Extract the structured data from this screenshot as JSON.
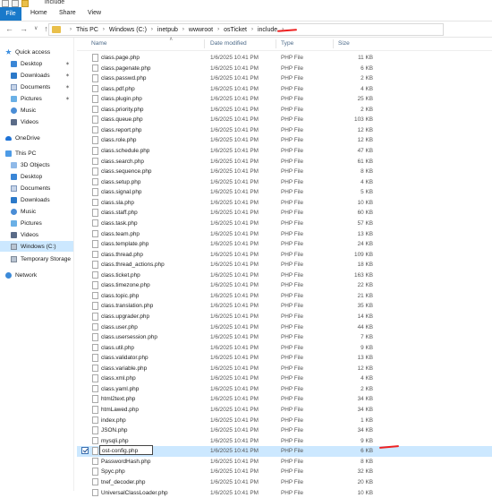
{
  "window": {
    "title": "include"
  },
  "ribbon": {
    "tabs": [
      "File",
      "Home",
      "Share",
      "View"
    ]
  },
  "address": {
    "crumbs": [
      "This PC",
      "Windows (C:)",
      "inetpub",
      "wwwroot",
      "osTicket",
      "include"
    ]
  },
  "sidebar": {
    "items": [
      {
        "label": "Quick access",
        "icon": "star-icon",
        "pinned": false
      },
      {
        "label": "Desktop",
        "icon": "desktop-icon",
        "pinned": true
      },
      {
        "label": "Downloads",
        "icon": "downloads-icon",
        "pinned": true
      },
      {
        "label": "Documents",
        "icon": "documents-icon",
        "pinned": true
      },
      {
        "label": "Pictures",
        "icon": "pictures-icon",
        "pinned": true
      },
      {
        "label": "Music",
        "icon": "music-icon",
        "pinned": false
      },
      {
        "label": "Videos",
        "icon": "videos-icon",
        "pinned": false
      },
      {
        "label": "OneDrive",
        "icon": "onedrive-icon",
        "pinned": false
      },
      {
        "label": "This PC",
        "icon": "pc-icon",
        "pinned": false
      },
      {
        "label": "3D Objects",
        "icon": "3d-objects-icon",
        "pinned": false
      },
      {
        "label": "Desktop",
        "icon": "desktop-icon",
        "pinned": false
      },
      {
        "label": "Documents",
        "icon": "documents-icon",
        "pinned": false
      },
      {
        "label": "Downloads",
        "icon": "downloads-icon",
        "pinned": false
      },
      {
        "label": "Music",
        "icon": "music-icon",
        "pinned": false
      },
      {
        "label": "Pictures",
        "icon": "pictures-icon",
        "pinned": false
      },
      {
        "label": "Videos",
        "icon": "videos-icon",
        "pinned": false
      },
      {
        "label": "Windows (C:)",
        "icon": "drive-icon",
        "pinned": false,
        "selected": true
      },
      {
        "label": "Temporary Storage",
        "icon": "drive-icon",
        "pinned": false
      },
      {
        "label": "Network",
        "icon": "network-icon",
        "pinned": false
      }
    ]
  },
  "columns": {
    "name": "Name",
    "date": "Date modified",
    "type": "Type",
    "size": "Size"
  },
  "files": [
    {
      "name": "class.page.php",
      "date": "1/6/2025 10:41 PM",
      "type": "PHP File",
      "size": "11 KB"
    },
    {
      "name": "class.pagenate.php",
      "date": "1/6/2025 10:41 PM",
      "type": "PHP File",
      "size": "6 KB"
    },
    {
      "name": "class.passwd.php",
      "date": "1/6/2025 10:41 PM",
      "type": "PHP File",
      "size": "2 KB"
    },
    {
      "name": "class.pdf.php",
      "date": "1/6/2025 10:41 PM",
      "type": "PHP File",
      "size": "4 KB"
    },
    {
      "name": "class.plugin.php",
      "date": "1/6/2025 10:41 PM",
      "type": "PHP File",
      "size": "25 KB"
    },
    {
      "name": "class.priority.php",
      "date": "1/6/2025 10:41 PM",
      "type": "PHP File",
      "size": "2 KB"
    },
    {
      "name": "class.queue.php",
      "date": "1/6/2025 10:41 PM",
      "type": "PHP File",
      "size": "103 KB"
    },
    {
      "name": "class.report.php",
      "date": "1/6/2025 10:41 PM",
      "type": "PHP File",
      "size": "12 KB"
    },
    {
      "name": "class.role.php",
      "date": "1/6/2025 10:41 PM",
      "type": "PHP File",
      "size": "12 KB"
    },
    {
      "name": "class.schedule.php",
      "date": "1/6/2025 10:41 PM",
      "type": "PHP File",
      "size": "47 KB"
    },
    {
      "name": "class.search.php",
      "date": "1/6/2025 10:41 PM",
      "type": "PHP File",
      "size": "61 KB"
    },
    {
      "name": "class.sequence.php",
      "date": "1/6/2025 10:41 PM",
      "type": "PHP File",
      "size": "8 KB"
    },
    {
      "name": "class.setup.php",
      "date": "1/6/2025 10:41 PM",
      "type": "PHP File",
      "size": "4 KB"
    },
    {
      "name": "class.signal.php",
      "date": "1/6/2025 10:41 PM",
      "type": "PHP File",
      "size": "5 KB"
    },
    {
      "name": "class.sla.php",
      "date": "1/6/2025 10:41 PM",
      "type": "PHP File",
      "size": "10 KB"
    },
    {
      "name": "class.staff.php",
      "date": "1/6/2025 10:41 PM",
      "type": "PHP File",
      "size": "60 KB"
    },
    {
      "name": "class.task.php",
      "date": "1/6/2025 10:41 PM",
      "type": "PHP File",
      "size": "57 KB"
    },
    {
      "name": "class.team.php",
      "date": "1/6/2025 10:41 PM",
      "type": "PHP File",
      "size": "13 KB"
    },
    {
      "name": "class.template.php",
      "date": "1/6/2025 10:41 PM",
      "type": "PHP File",
      "size": "24 KB"
    },
    {
      "name": "class.thread.php",
      "date": "1/6/2025 10:41 PM",
      "type": "PHP File",
      "size": "109 KB"
    },
    {
      "name": "class.thread_actions.php",
      "date": "1/6/2025 10:41 PM",
      "type": "PHP File",
      "size": "18 KB"
    },
    {
      "name": "class.ticket.php",
      "date": "1/6/2025 10:41 PM",
      "type": "PHP File",
      "size": "163 KB"
    },
    {
      "name": "class.timezone.php",
      "date": "1/6/2025 10:41 PM",
      "type": "PHP File",
      "size": "22 KB"
    },
    {
      "name": "class.topic.php",
      "date": "1/6/2025 10:41 PM",
      "type": "PHP File",
      "size": "21 KB"
    },
    {
      "name": "class.translation.php",
      "date": "1/6/2025 10:41 PM",
      "type": "PHP File",
      "size": "35 KB"
    },
    {
      "name": "class.upgrader.php",
      "date": "1/6/2025 10:41 PM",
      "type": "PHP File",
      "size": "14 KB"
    },
    {
      "name": "class.user.php",
      "date": "1/6/2025 10:41 PM",
      "type": "PHP File",
      "size": "44 KB"
    },
    {
      "name": "class.usersession.php",
      "date": "1/6/2025 10:41 PM",
      "type": "PHP File",
      "size": "7 KB"
    },
    {
      "name": "class.util.php",
      "date": "1/6/2025 10:41 PM",
      "type": "PHP File",
      "size": "9 KB"
    },
    {
      "name": "class.validator.php",
      "date": "1/6/2025 10:41 PM",
      "type": "PHP File",
      "size": "13 KB"
    },
    {
      "name": "class.variable.php",
      "date": "1/6/2025 10:41 PM",
      "type": "PHP File",
      "size": "12 KB"
    },
    {
      "name": "class.xml.php",
      "date": "1/6/2025 10:41 PM",
      "type": "PHP File",
      "size": "4 KB"
    },
    {
      "name": "class.yaml.php",
      "date": "1/6/2025 10:41 PM",
      "type": "PHP File",
      "size": "2 KB"
    },
    {
      "name": "html2text.php",
      "date": "1/6/2025 10:41 PM",
      "type": "PHP File",
      "size": "34 KB"
    },
    {
      "name": "htmLawed.php",
      "date": "1/6/2025 10:41 PM",
      "type": "PHP File",
      "size": "34 KB"
    },
    {
      "name": "index.php",
      "date": "1/6/2025 10:41 PM",
      "type": "PHP File",
      "size": "1 KB"
    },
    {
      "name": "JSON.php",
      "date": "1/6/2025 10:41 PM",
      "type": "PHP File",
      "size": "34 KB"
    },
    {
      "name": "mysqli.php",
      "date": "1/6/2025 10:41 PM",
      "type": "PHP File",
      "size": "9 KB"
    },
    {
      "name": "ost-config.php",
      "date": "1/6/2025 10:41 PM",
      "type": "PHP File",
      "size": "6 KB",
      "selected": true,
      "editing": true
    },
    {
      "name": "PasswordHash.php",
      "date": "1/6/2025 10:41 PM",
      "type": "PHP File",
      "size": "8 KB"
    },
    {
      "name": "Spyc.php",
      "date": "1/6/2025 10:41 PM",
      "type": "PHP File",
      "size": "32 KB"
    },
    {
      "name": "tnef_decoder.php",
      "date": "1/6/2025 10:41 PM",
      "type": "PHP File",
      "size": "20 KB"
    },
    {
      "name": "UniversalClassLoader.php",
      "date": "1/6/2025 10:41 PM",
      "type": "PHP File",
      "size": "10 KB"
    }
  ],
  "colors": {
    "selection": "#cce8ff",
    "file_tab": "#1979ca",
    "annotation": "#e22222",
    "folder": "#e9bf4a"
  }
}
